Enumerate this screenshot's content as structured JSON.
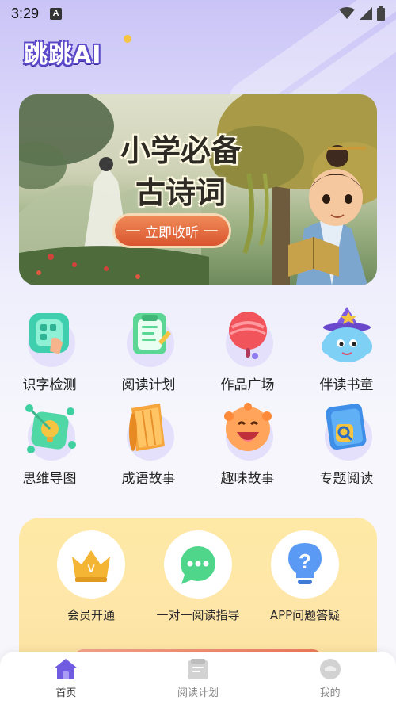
{
  "status_bar": {
    "time": "3:29",
    "notification_glyph": "A",
    "icons": [
      "wifi-icon",
      "signal-icon",
      "battery-icon"
    ]
  },
  "app": {
    "logo_text": "跳跳AI"
  },
  "banner": {
    "title_line1": "小学必备",
    "title_line2": "古诗词",
    "button_label": "立即收听"
  },
  "features": [
    {
      "label": "识字检测",
      "icon": "literacy-check-icon"
    },
    {
      "label": "阅读计划",
      "icon": "reading-plan-icon"
    },
    {
      "label": "作品广场",
      "icon": "works-plaza-icon"
    },
    {
      "label": "伴读书童",
      "icon": "reading-buddy-icon"
    },
    {
      "label": "思维导图",
      "icon": "mind-map-icon"
    },
    {
      "label": "成语故事",
      "icon": "idiom-story-icon"
    },
    {
      "label": "趣味故事",
      "icon": "fun-story-icon"
    },
    {
      "label": "专题阅读",
      "icon": "topic-reading-icon"
    }
  ],
  "services": [
    {
      "label": "会员开通",
      "icon": "crown-icon"
    },
    {
      "label": "一对一阅读指导",
      "icon": "chat-bubble-icon"
    },
    {
      "label": "APP问题答疑",
      "icon": "lightbulb-question-icon"
    }
  ],
  "bottom_nav": [
    {
      "label": "首页",
      "icon": "home-icon",
      "active": true
    },
    {
      "label": "阅读计划",
      "icon": "book-icon",
      "active": false
    },
    {
      "label": "我的",
      "icon": "profile-icon",
      "active": false
    }
  ],
  "colors": {
    "accent_purple": "#6f5ce0",
    "banner_button": "#e06638",
    "service_card": "#fde6a8"
  }
}
